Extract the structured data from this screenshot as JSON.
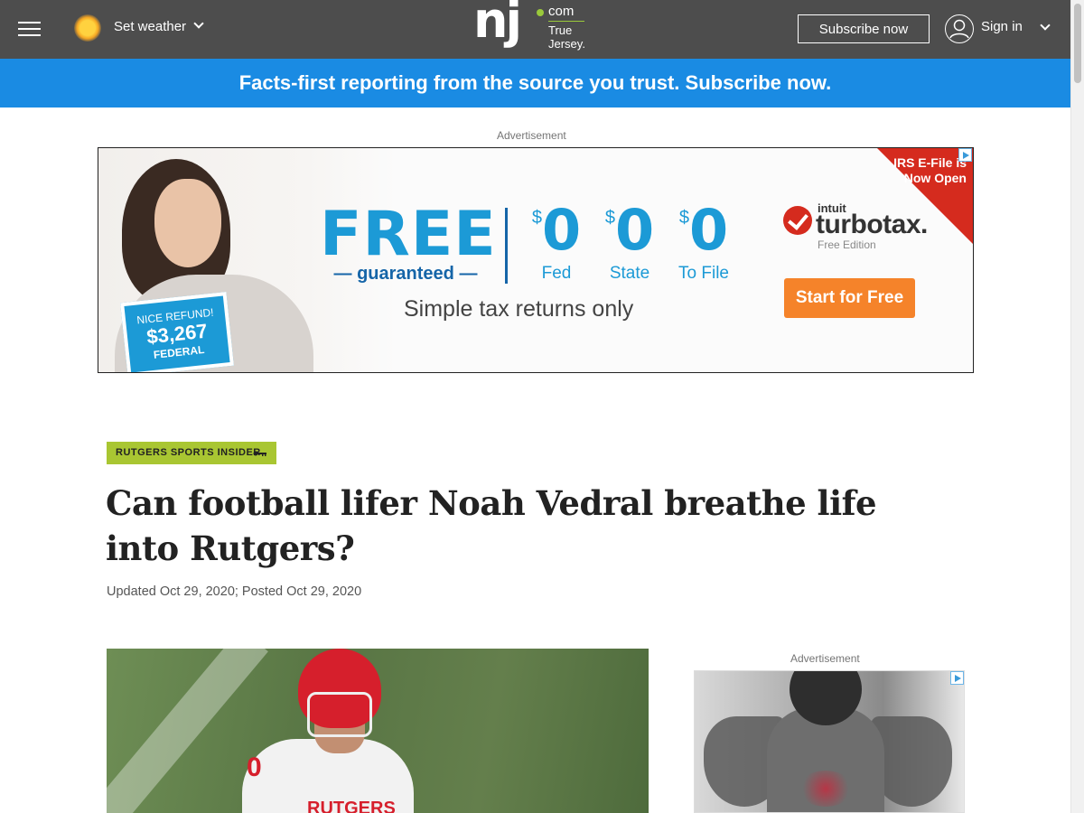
{
  "nav": {
    "weather_label": "Set weather",
    "logo_com": "com",
    "logo_tagline": "True Jersey.",
    "subscribe_label": "Subscribe now",
    "signin_label": "Sign in"
  },
  "promo": {
    "text": "Facts-first reporting from the source you trust. Subscribe now."
  },
  "ad_top": {
    "label": "Advertisement",
    "sign": {
      "line1": "NICE REFUND!",
      "amount": "$3,267",
      "line3": "FEDERAL"
    },
    "headline": "FREE",
    "guarantee": "— guaranteed —",
    "offers": [
      {
        "currency": "$",
        "amount": "0",
        "label": "Fed"
      },
      {
        "currency": "$",
        "amount": "0",
        "label": "State"
      },
      {
        "currency": "$",
        "amount": "0",
        "label": "To File"
      }
    ],
    "subline": "Simple tax returns only",
    "brand_top": "intuit",
    "brand": "turbotax.",
    "brand_edition": "Free Edition",
    "cta": "Start for Free",
    "corner_text": "IRS E-File is Now Open",
    "colors": {
      "blue": "#1c9ad6",
      "orange": "#f5832a",
      "red": "#d52b1e"
    }
  },
  "article": {
    "kicker": "RUTGERS SPORTS INSIDER",
    "headline": "Can football lifer Noah Vedral breathe life into Rutgers?",
    "byline": "Updated Oct 29, 2020; Posted Oct 29, 2020",
    "hero_jersey_number": "0",
    "hero_jersey_text": "RUTGERS"
  },
  "ad_side": {
    "label": "Advertisement"
  },
  "colors": {
    "nav_bg": "#4d4d4d",
    "promo_bg": "#1a8be3",
    "kicker_bg": "#a9c632",
    "logo_accent": "#9ac93b"
  }
}
